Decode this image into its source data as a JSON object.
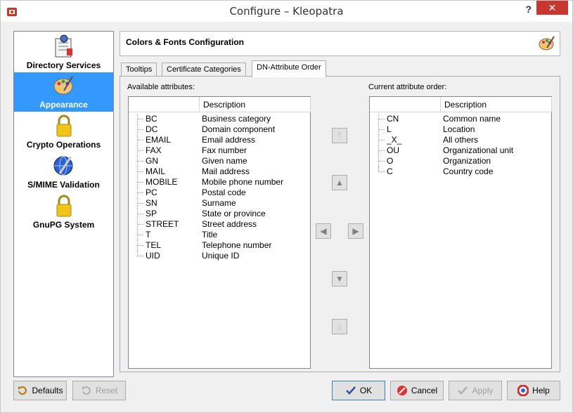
{
  "window": {
    "title": "Configure – Kleopatra",
    "help": "?",
    "close": "✕"
  },
  "sidebar": {
    "items": [
      {
        "label": "Directory Services",
        "icon": "directory-services-icon"
      },
      {
        "label": "Appearance",
        "icon": "palette-icon",
        "selected": true
      },
      {
        "label": "Crypto Operations",
        "icon": "lock-icon"
      },
      {
        "label": "S/MIME Validation",
        "icon": "globe-wrench-icon"
      },
      {
        "label": "GnuPG System",
        "icon": "lock-icon"
      }
    ]
  },
  "page": {
    "title": "Colors & Fonts Configuration",
    "icon": "palette-icon"
  },
  "tabs": [
    {
      "label": "Tooltips"
    },
    {
      "label": "Certificate Categories"
    },
    {
      "label": "DN-Attribute Order",
      "active": true
    }
  ],
  "available": {
    "label": "Available attributes:",
    "columns": [
      "",
      "Description"
    ],
    "rows": [
      {
        "code": "BC",
        "desc": "Business category"
      },
      {
        "code": "DC",
        "desc": "Domain component"
      },
      {
        "code": "EMAIL",
        "desc": "Email address"
      },
      {
        "code": "FAX",
        "desc": "Fax number"
      },
      {
        "code": "GN",
        "desc": "Given name"
      },
      {
        "code": "MAIL",
        "desc": "Mail address"
      },
      {
        "code": "MOBILE",
        "desc": "Mobile phone number"
      },
      {
        "code": "PC",
        "desc": "Postal code"
      },
      {
        "code": "SN",
        "desc": "Surname"
      },
      {
        "code": "SP",
        "desc": "State or province"
      },
      {
        "code": "STREET",
        "desc": "Street address"
      },
      {
        "code": "T",
        "desc": "Title"
      },
      {
        "code": "TEL",
        "desc": "Telephone number"
      },
      {
        "code": "UID",
        "desc": "Unique ID"
      }
    ]
  },
  "current": {
    "label": "Current attribute order:",
    "columns": [
      "",
      "Description"
    ],
    "rows": [
      {
        "code": "CN",
        "desc": "Common name"
      },
      {
        "code": "L",
        "desc": "Location"
      },
      {
        "code": "_X_",
        "desc": "All others"
      },
      {
        "code": "OU",
        "desc": "Organizational unit"
      },
      {
        "code": "O",
        "desc": "Organization"
      },
      {
        "code": "C",
        "desc": "Country code"
      }
    ]
  },
  "arrows": {
    "top": "⤒",
    "up": "▲",
    "left": "◀",
    "right": "▶",
    "down": "▼",
    "bottom": "⤓"
  },
  "buttons": {
    "defaults": "Defaults",
    "reset": "Reset",
    "ok": "OK",
    "cancel": "Cancel",
    "apply": "Apply",
    "help": "Help"
  },
  "colors": {
    "selection": "#3399ff",
    "close": "#c7372f"
  }
}
